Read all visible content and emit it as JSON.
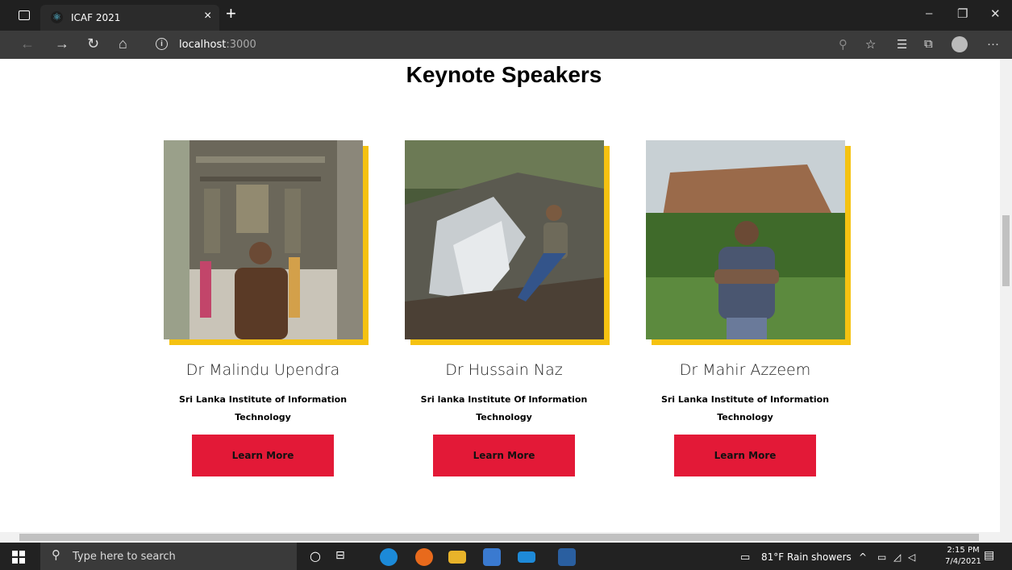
{
  "browser": {
    "tab_title": "ICAF 2021",
    "address_host": "localhost",
    "address_port": ":3000"
  },
  "page": {
    "heading": "Keynote Speakers",
    "speakers": [
      {
        "name": "Dr Malindu Upendra",
        "org_line1": "Sri Lanka Institute of Information",
        "org_line2": "Technology",
        "button": "Learn More"
      },
      {
        "name": "Dr Hussain Naz",
        "org_line1": "Sri lanka Institute Of Information",
        "org_line2": "Technology",
        "button": "Learn More"
      },
      {
        "name": "Dr Mahir Azzeem",
        "org_line1": "Sri Lanka Institute of Information",
        "org_line2": "Technology",
        "button": "Learn More"
      }
    ],
    "accent_color": "#f5c211",
    "button_color": "#e31937"
  },
  "taskbar": {
    "search_placeholder": "Type here to search",
    "weather": "81°F  Rain showers",
    "time": "2:15 PM",
    "date": "7/4/2021"
  }
}
